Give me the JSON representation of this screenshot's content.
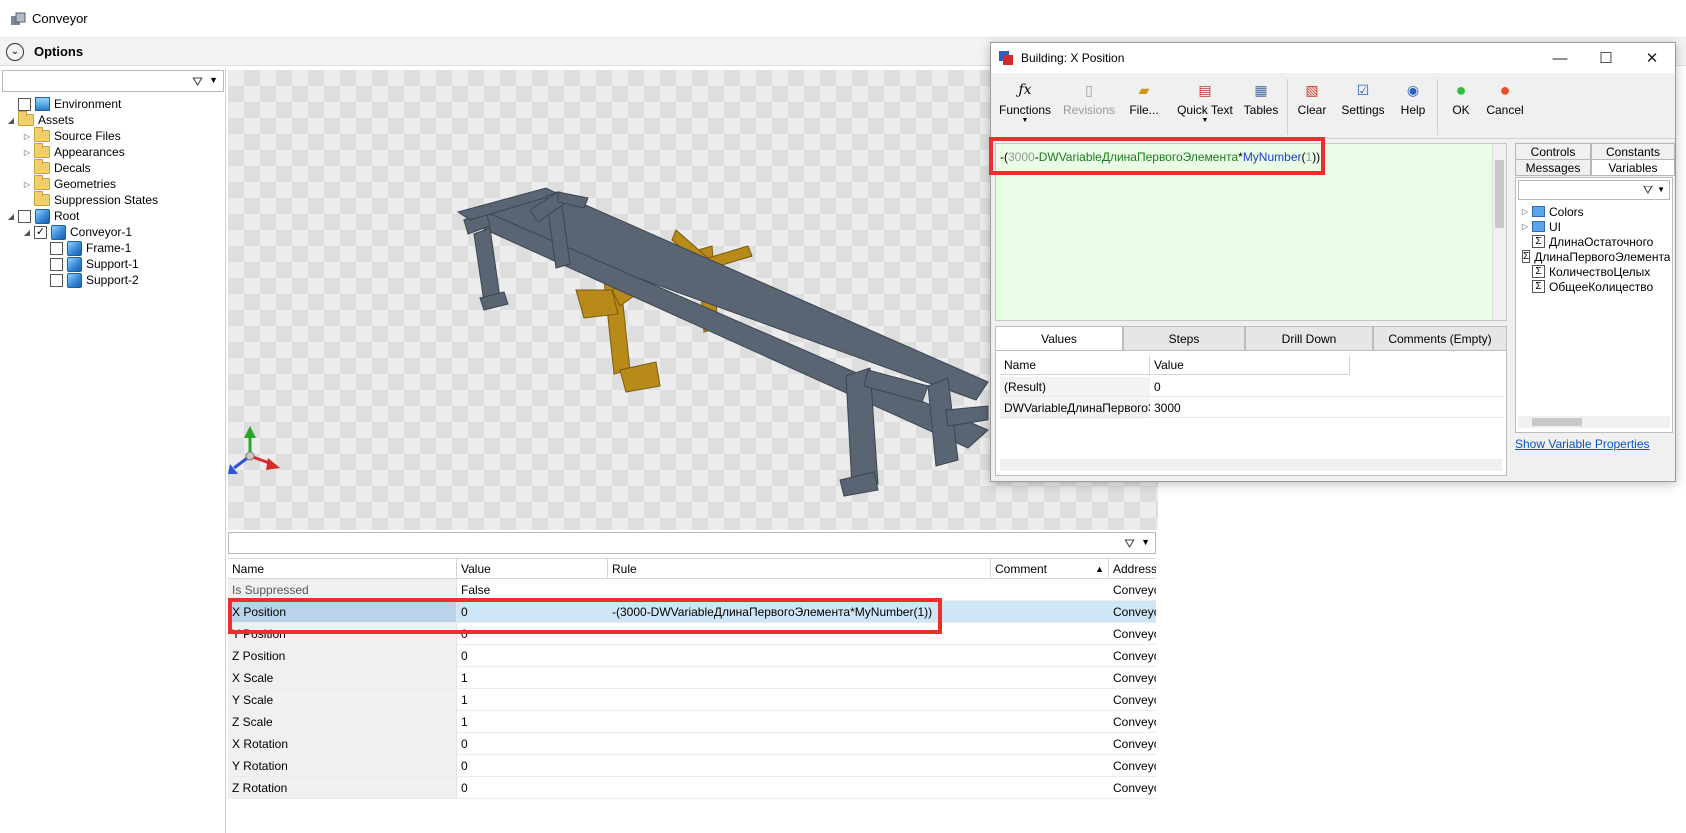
{
  "window": {
    "title": "Conveyor"
  },
  "options": {
    "label": "Options"
  },
  "tree": {
    "items": [
      {
        "label": "Environment"
      },
      {
        "label": "Assets"
      },
      {
        "label": "Source Files"
      },
      {
        "label": "Appearances"
      },
      {
        "label": "Decals"
      },
      {
        "label": "Geometries"
      },
      {
        "label": "Suppression States"
      },
      {
        "label": "Root"
      },
      {
        "label": "Conveyor-1"
      },
      {
        "label": "Frame-1"
      },
      {
        "label": "Support-1"
      },
      {
        "label": "Support-2"
      }
    ]
  },
  "properties": {
    "headers": {
      "name": "Name",
      "value": "Value",
      "rule": "Rule",
      "comment": "Comment",
      "address": "Address"
    },
    "rows": [
      {
        "name": "Is Suppressed",
        "value": "False",
        "rule": "",
        "address": "Conveyor"
      },
      {
        "name": "X Position",
        "value": "0",
        "rule": "-(3000-DWVariableДлинаПервогоЭлемента*MyNumber(1))",
        "address": "Conveyor"
      },
      {
        "name": "Y Position",
        "value": "0",
        "rule": "",
        "address": "Conveyor"
      },
      {
        "name": "Z Position",
        "value": "0",
        "rule": "",
        "address": "Conveyor"
      },
      {
        "name": "X Scale",
        "value": "1",
        "rule": "",
        "address": "Conveyor"
      },
      {
        "name": "Y Scale",
        "value": "1",
        "rule": "",
        "address": "Conveyor"
      },
      {
        "name": "Z Scale",
        "value": "1",
        "rule": "",
        "address": "Conveyor"
      },
      {
        "name": "X Rotation",
        "value": "0",
        "rule": "",
        "address": "Conveyor"
      },
      {
        "name": "Y Rotation",
        "value": "0",
        "rule": "",
        "address": "Conveyor"
      },
      {
        "name": "Z Rotation",
        "value": "0",
        "rule": "",
        "address": "Conveyor"
      }
    ]
  },
  "dialog": {
    "title": "Building: X Position",
    "toolbar": {
      "functions": "Functions",
      "revisions": "Revisions",
      "file": "File...",
      "quick_text": "Quick Text",
      "tables": "Tables",
      "clear": "Clear",
      "settings": "Settings",
      "help": "Help",
      "ok": "OK",
      "cancel": "Cancel"
    },
    "expression": {
      "open": "-(",
      "num": "3000",
      "minus": "-",
      "var": "DWVariableДлинаПервогоЭлемента",
      "times": "*",
      "func": "MyNumber",
      "paren_open": "(",
      "arg": "1",
      "close": "))"
    },
    "tabs": {
      "values": "Values",
      "steps": "Steps",
      "drill_down": "Drill Down",
      "comments": "Comments (Empty)"
    },
    "grid": {
      "headers": {
        "name": "Name",
        "value": "Value"
      },
      "rows": [
        {
          "name": "(Result)",
          "value": "0"
        },
        {
          "name": "DWVariableДлинаПервогоЭлемента",
          "value": "3000"
        }
      ]
    },
    "side_tabs": {
      "controls": "Controls",
      "constants": "Constants",
      "messages": "Messages",
      "variables": "Variables"
    },
    "variables": [
      {
        "label": "Colors",
        "kind": "folder"
      },
      {
        "label": "UI",
        "kind": "folder"
      },
      {
        "label": "ДлинаОстаточного",
        "kind": "var"
      },
      {
        "label": "ДлинаПервогоЭлемента",
        "kind": "var"
      },
      {
        "label": "КоличествоЦелых",
        "kind": "var"
      },
      {
        "label": "ОбщееКолицество",
        "kind": "var"
      }
    ],
    "show_var_props": "Show Variable Properties"
  },
  "colors": {
    "highlight": "#ee2d2d",
    "editor_bg": "#e8fce6",
    "frame_gray": "#596573",
    "support_gold": "#b78a1a"
  }
}
